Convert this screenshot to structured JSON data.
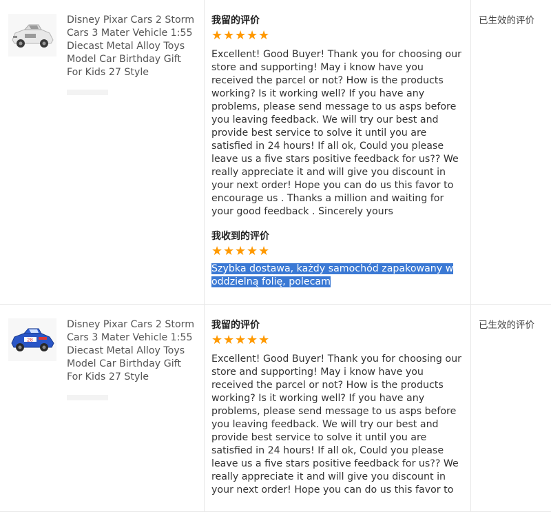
{
  "reviews": [
    {
      "product_title": "Disney Pixar Cars 2 Storm Cars 3 Mater Vehicle 1:55 Diecast Metal Alloy Toys Model Car Birthday Gift For Kids 27 Style",
      "my_review_heading": "我留的评价",
      "my_rating": 5,
      "my_review_text": "Excellent! Good Buyer! Thank you for choosing our store and supporting! May i know have you received the parcel or not? How is the products working? Is it working well? If you have any problems, please send message to us asps before you leaving feedback. We will try our best and provide best service to solve it until you are satisfied in 24 hours! If all ok, Could you please leave us a five stars positive feedback for us?? We really appreciate it and will give you discount in your next order! Hope you can do us this favor to encourage us . Thanks a million and waiting for your good feedback . Sincerely yours",
      "received_heading": "我收到的评价",
      "received_rating": 5,
      "received_text": "Szybka dostawa, każdy samochód zapakowany w oddzielną folię, polecam",
      "status": "已生效的评价",
      "car_colors": {
        "body": "#e8e8e8",
        "accent": "#9a9a9a"
      }
    },
    {
      "product_title": "Disney Pixar Cars 2 Storm Cars 3 Mater Vehicle 1:55 Diecast Metal Alloy Toys Model Car Birthday Gift For Kids 27 Style",
      "my_review_heading": "我留的评价",
      "my_rating": 5,
      "my_review_text": "Excellent! Good Buyer! Thank you for choosing our store and supporting! May i know have you received the parcel or not? How is the products working? Is it working well? If you have any problems, please send message to us asps before you leaving feedback. We will try our best and provide best service to solve it until you are satisfied in 24 hours! If all ok, Could you please leave us a five stars positive feedback for us?? We really appreciate it and will give you discount in your next order! Hope you can do us this favor to",
      "status": "已生效的评价",
      "car_colors": {
        "body": "#2a56c6",
        "accent": "#d83a3a"
      }
    }
  ],
  "colors": {
    "star": "#ff9900",
    "selection": "#3b79d4",
    "divider": "#e8e8e8"
  }
}
